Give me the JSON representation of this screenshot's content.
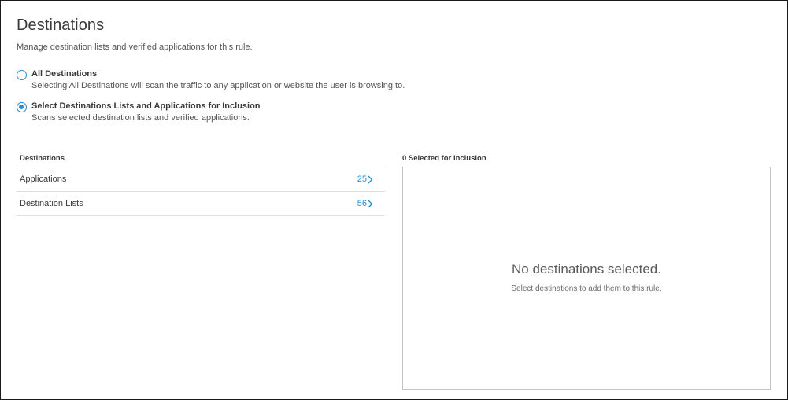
{
  "page": {
    "title": "Destinations",
    "subtitle": "Manage destination lists and verified applications for this rule."
  },
  "options": [
    {
      "label": "All Destinations",
      "description": "Selecting All Destinations will scan the traffic to any application or website the user is browsing to.",
      "selected": false
    },
    {
      "label": "Select Destinations Lists and Applications for Inclusion",
      "description": "Scans selected destination lists and verified applications.",
      "selected": true
    }
  ],
  "destinations": {
    "header": "Destinations",
    "rows": [
      {
        "name": "Applications",
        "count": "25",
        "icon": "chevron-right-icon"
      },
      {
        "name": "Destination Lists",
        "count": "56",
        "icon": "chevron-right-icon"
      }
    ]
  },
  "selection": {
    "header": "0 Selected for Inclusion",
    "empty_title": "No destinations selected.",
    "empty_description": "Select destinations to add them to this rule."
  },
  "colors": {
    "accent": "#1b8fd6",
    "text": "#39393b",
    "border": "#dedede"
  }
}
